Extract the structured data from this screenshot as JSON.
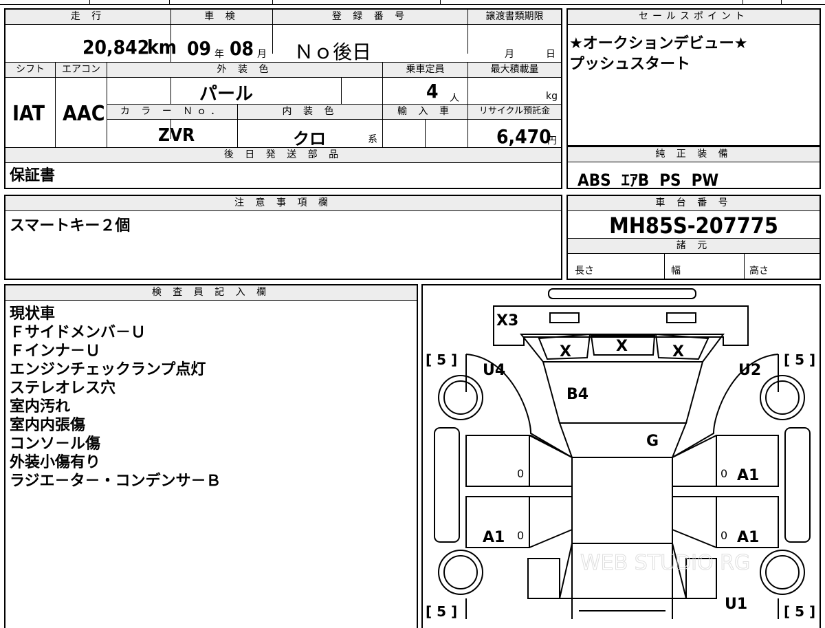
{
  "top": {
    "mileage_label": "走 行",
    "mileage": "20,842",
    "mileage_unit": "km",
    "inspection_label": "車 検",
    "inspection_year": "09",
    "inspection_year_unit": "年",
    "inspection_month": "08",
    "inspection_month_unit": "月",
    "registration_label": "登 録 番 号",
    "registration": "Ｎｏ後日",
    "transfer_label": "譲渡書類期限",
    "transfer_month": "月",
    "transfer_day": "日"
  },
  "spec": {
    "shift_label": "シフト",
    "shift": "IAT",
    "ac_label": "エアコン",
    "ac": "AAC",
    "exterior_label": "外 装 色",
    "exterior": "パール",
    "capacity_label": "乗車定員",
    "capacity": "4",
    "capacity_unit": "人",
    "max_load_label": "最大積載量",
    "max_load_unit": "kg",
    "color_no_label": "カ ラ ー Ｎｏ．",
    "color_no": "ZVR",
    "interior_label": "内 装 色",
    "interior": "クロ",
    "interior_unit": "系",
    "import_label": "輸 入 車",
    "recycle_label": "リサイクル預託金",
    "recycle": "6,470",
    "recycle_unit": "円"
  },
  "later_parts": {
    "label": "後 日 発 送 部 品",
    "value": "保証書"
  },
  "sales_point": {
    "label": "セールスポイント",
    "lines": [
      "★オークションデビュー★",
      "プッシュスタート"
    ]
  },
  "equipment": {
    "label": "純 正 装 備",
    "value": "ABS  ｴｱB  PS  PW"
  },
  "caution": {
    "label": "注 意 事 項 欄",
    "value": "スマートキー２個"
  },
  "chassis": {
    "label": "車 台 番 号",
    "value": "MH85S-207775",
    "spec_label": "諸 元",
    "length_label": "長さ",
    "width_label": "幅",
    "height_label": "高さ"
  },
  "inspector": {
    "label": "検 査 員 記 入 欄",
    "notes": [
      "現状車",
      "Ｆサイドメンバ－Ｕ",
      "Ｆインナ－Ｕ",
      "エンジンチェックランプ点灯",
      "ステレオレス穴",
      "室内汚れ",
      "室内内張傷",
      "コンソ－ル傷",
      "外装小傷有り",
      "ラジエ－タ－・コンデンサ－Ｂ"
    ]
  },
  "diagram": {
    "x3": "X3",
    "x_left": "X",
    "x_center": "X",
    "x_right": "X",
    "u4": "U4",
    "u2": "U2",
    "u1": "U1",
    "b4": "B4",
    "g": "G",
    "a1_right_front": "A1",
    "a1_left_rear": "A1",
    "a1_right_rear": "A1",
    "tire_fl": "[ 5 ]",
    "tire_fr": "[ 5 ]",
    "tire_rl": "[ 5 ]",
    "tire_rr": "[ 5 ]",
    "zero": "0"
  },
  "watermark": "WEB STUDIO RG"
}
